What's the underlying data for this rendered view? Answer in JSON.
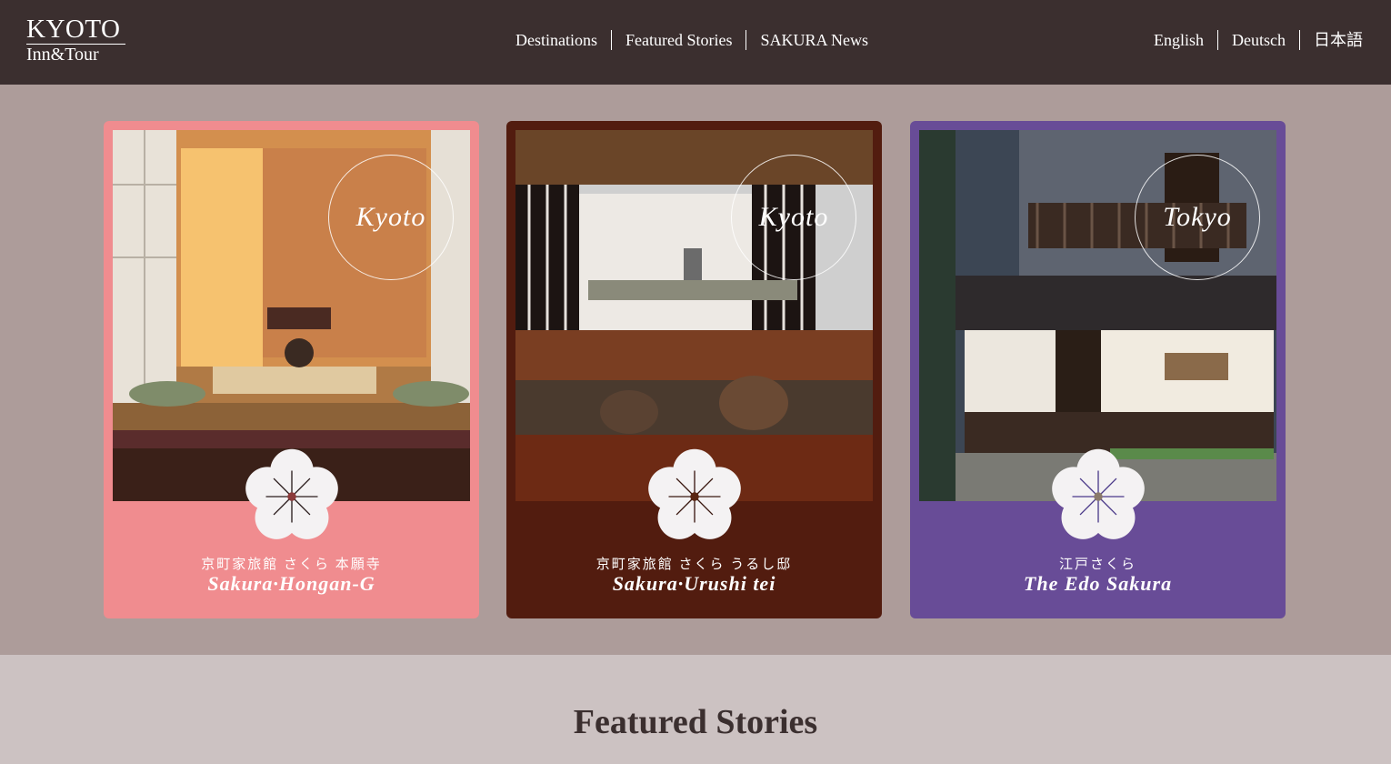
{
  "header": {
    "logo_top": "KYOTO",
    "logo_bottom": "Inn&Tour",
    "nav": [
      "Destinations",
      "Featured Stories",
      "SAKURA News"
    ],
    "languages": [
      "English",
      "Deutsch",
      "日本語"
    ]
  },
  "cards": [
    {
      "city": "Kyoto",
      "jp_name": "京町家旅館 さくら 本願寺",
      "name": "Sakura·Hongan-G",
      "accent": "#f08c8f",
      "petal_lines": "#2a1c1c",
      "center": "#8b3a3a"
    },
    {
      "city": "Kyoto",
      "jp_name": "京町家旅館 さくら うるし邸",
      "name": "Sakura·Urushi tei",
      "accent": "#521c0f",
      "petal_lines": "#3a1810",
      "center": "#5a2612"
    },
    {
      "city": "Tokyo",
      "jp_name": "江戸さくら",
      "name": "The Edo Sakura",
      "accent": "#684c97",
      "petal_lines": "#4b3a8a",
      "center": "#8a7a6a"
    }
  ],
  "featured": {
    "title": "Featured Stories"
  }
}
